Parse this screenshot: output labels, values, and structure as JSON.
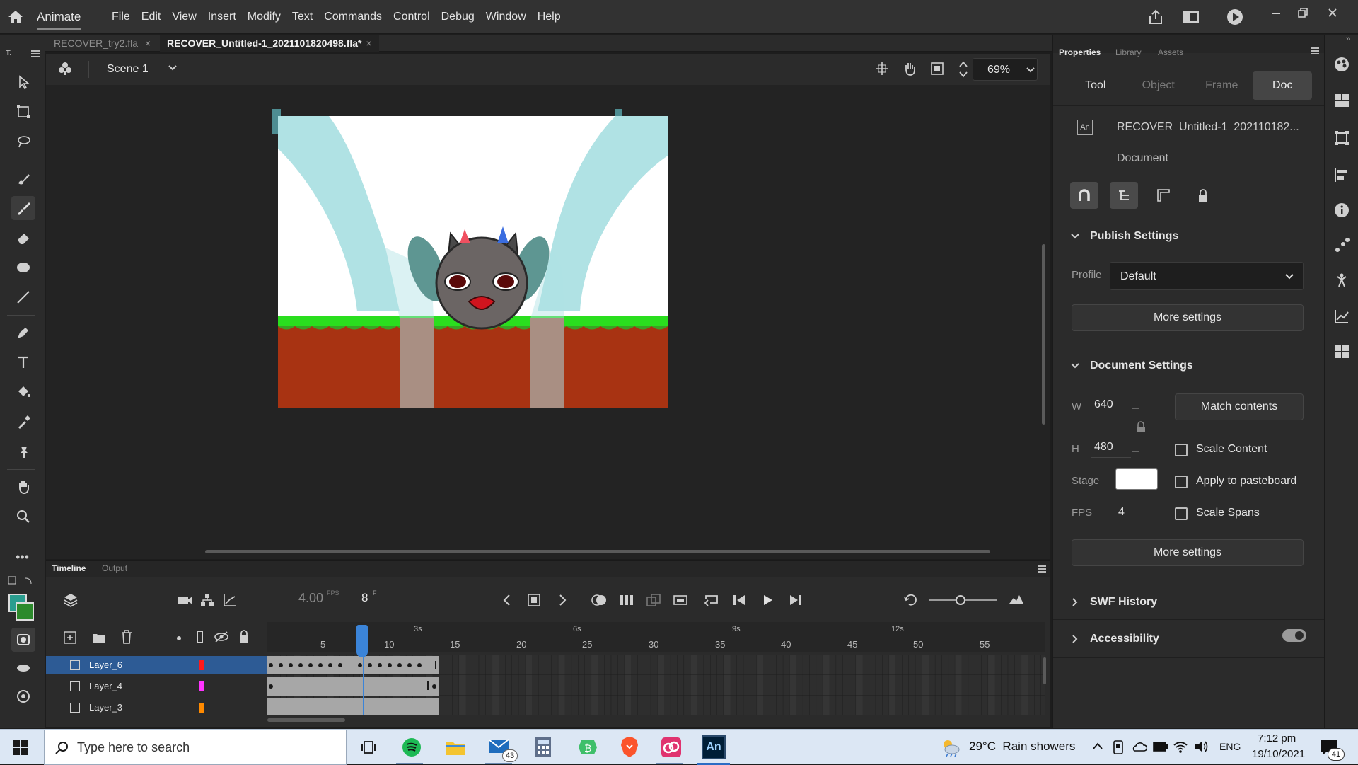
{
  "app": {
    "name": "Animate"
  },
  "menus": [
    "File",
    "Edit",
    "View",
    "Insert",
    "Modify",
    "Text",
    "Commands",
    "Control",
    "Debug",
    "Window",
    "Help"
  ],
  "tabs": [
    {
      "label": "RECOVER_try2.fla",
      "active": false
    },
    {
      "label": "RECOVER_Untitled-1_2021101820498.fla*",
      "active": true
    }
  ],
  "scene": {
    "name": "Scene 1",
    "zoom": "69%"
  },
  "tools_panel": {
    "label": "T."
  },
  "timeline": {
    "tabs": [
      "Timeline",
      "Output"
    ],
    "fps_value": "4.00",
    "fps_unit": "FPS",
    "current_frame": "8",
    "frame_unit": "F",
    "time_labels": [
      "3s",
      "6s",
      "9s",
      "12s"
    ],
    "frame_labels": [
      "5",
      "10",
      "15",
      "20",
      "25",
      "30",
      "35",
      "40",
      "45",
      "50",
      "55"
    ],
    "layers": [
      {
        "name": "Layer_6",
        "color": "#ff1a1a",
        "selected": true
      },
      {
        "name": "Layer_4",
        "color": "#ff33ff",
        "selected": false
      },
      {
        "name": "Layer_3",
        "color": "#ff8a00",
        "selected": false
      }
    ]
  },
  "properties": {
    "panel_tabs": [
      "Properties",
      "Library",
      "Assets"
    ],
    "mode_tabs": [
      "Tool",
      "Object",
      "Frame",
      "Doc"
    ],
    "active_mode": "Doc",
    "doc_icon_text": "An",
    "doc_name": "RECOVER_Untitled-1_202110182...",
    "doc_type": "Document",
    "publish_settings": {
      "title": "Publish Settings",
      "profile_label": "Profile",
      "profile_value": "Default",
      "more_settings": "More settings"
    },
    "document_settings": {
      "title": "Document Settings",
      "w_label": "W",
      "w_value": "640",
      "h_label": "H",
      "h_value": "480",
      "match_contents": "Match contents",
      "scale_content": "Scale Content",
      "stage_label": "Stage",
      "stage_color": "#ffffff",
      "apply_pasteboard": "Apply to pasteboard",
      "fps_label": "FPS",
      "fps_value": "4",
      "scale_spans": "Scale Spans",
      "more_settings": "More settings"
    },
    "swf_history": "SWF History",
    "accessibility": "Accessibility"
  },
  "taskbar": {
    "search_placeholder": "Type here to search",
    "mail_badge": "43",
    "weather": "29°C  Rain showers",
    "language": "ENG",
    "time": "7:12 pm",
    "date": "19/10/2021",
    "notif_count": "41"
  }
}
